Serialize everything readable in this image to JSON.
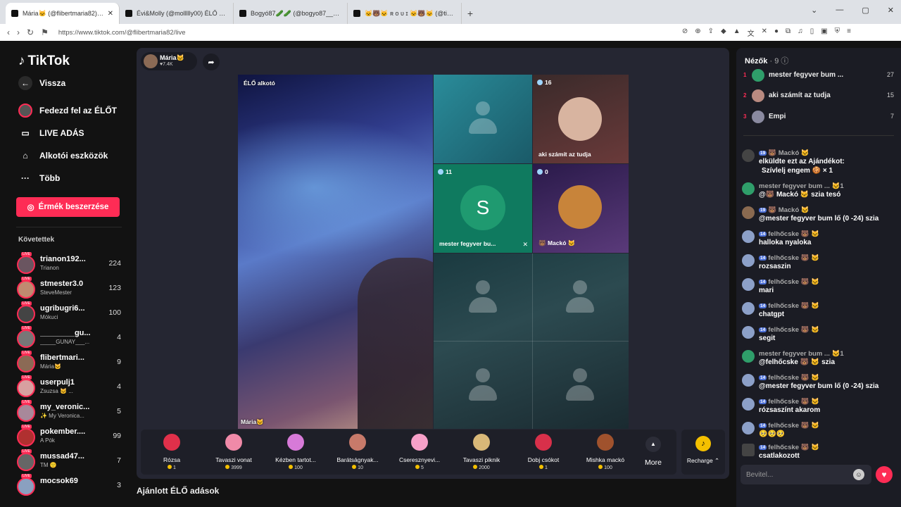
{
  "browser": {
    "tabs": [
      {
        "title": "Mária🐱 (@flibertmaria82) ÉL",
        "active": true
      },
      {
        "title": "Évi&Molly (@mollllly00) ÉLŐ adá",
        "active": false
      },
      {
        "title": "Bogyó87🥒🥒 (@bogyo87__) ÉLŐ adá",
        "active": false
      },
      {
        "title": "🐱🐻🐱 ʀ ᴏ ᴜ ɪ 🐱🐻🐱 (@tiktok.rolli",
        "active": false
      }
    ],
    "url": "https://www.tiktok.com/@flibertmaria82/live"
  },
  "sidebar": {
    "logo": "TikTok",
    "nav": [
      {
        "label": "Vissza",
        "icon": "back-arrow-icon"
      },
      {
        "label": "Fedezd fel az ÉLŐT",
        "icon": "explore-live-icon"
      },
      {
        "label": "LIVE ADÁS",
        "icon": "camera-icon"
      },
      {
        "label": "Alkotói eszközök",
        "icon": "home-tools-icon"
      },
      {
        "label": "Több",
        "icon": "more-dots-icon"
      }
    ],
    "coins_button": "Érmék beszerzése",
    "following_title": "Követettek",
    "following": [
      {
        "name": "trianon192...",
        "sub": "Trianon",
        "count": "224"
      },
      {
        "name": "stmester3.0",
        "sub": "SteveMester",
        "count": "123"
      },
      {
        "name": "ugribugri6...",
        "sub": "Mókuci",
        "count": "100"
      },
      {
        "name": "________gu...",
        "sub": "_____GUNAY___...",
        "count": "4"
      },
      {
        "name": "flibertmari...",
        "sub": "Mária🐱",
        "count": "9"
      },
      {
        "name": "userpulj1",
        "sub": "Zsuzsa 🐱 ...",
        "count": "4"
      },
      {
        "name": "my_veronic...",
        "sub": "✨ My Veronica...",
        "count": "5"
      },
      {
        "name": "pokember....",
        "sub": "A Pók",
        "count": "99"
      },
      {
        "name": "mussad47...",
        "sub": "TM 🙂",
        "count": "7"
      },
      {
        "name": "mocsok69",
        "sub": "",
        "count": "3"
      }
    ]
  },
  "stream": {
    "host_name": "Mária🐱",
    "host_likes": "♥7.4K",
    "main_tag": "ÉLŐ alkotó",
    "main_name": "Mária🐱",
    "guests": [
      {
        "count": "",
        "name": ""
      },
      {
        "count": "16",
        "name": "aki számít az tudja"
      },
      {
        "count": "11",
        "name": "mester fegyver bu..."
      },
      {
        "count": "0",
        "name": "🐻 Mackó 🐱"
      }
    ],
    "guest_initial": "S"
  },
  "gifts": [
    {
      "name": "Rózsa",
      "price": "1",
      "color": "#e0304a"
    },
    {
      "name": "Tavaszi vonat",
      "price": "3999",
      "color": "#f08aa8"
    },
    {
      "name": "Kézben tartot...",
      "price": "100",
      "color": "#d77ad8"
    },
    {
      "name": "Barátságnyak...",
      "price": "10",
      "color": "#c77a6a"
    },
    {
      "name": "Cseresznyevi...",
      "price": "5",
      "color": "#f6a0c8"
    },
    {
      "name": "Tavaszi piknik",
      "price": "2000",
      "color": "#d8b878"
    },
    {
      "name": "Dobj csókot",
      "price": "1",
      "color": "#d8304a"
    },
    {
      "name": "Mishka mackó",
      "price": "100",
      "color": "#a0522d"
    }
  ],
  "more_label": "More",
  "recharge_label": "Recharge ⌃",
  "below_heading": "Ajánlott ÉLŐ adások",
  "viewers": {
    "title": "Nézők",
    "count": "· 9",
    "ranks": [
      {
        "rank": "1",
        "name": "mester fegyver bum ...",
        "value": "27",
        "color": "#2f9e6a"
      },
      {
        "rank": "2",
        "name": "aki számít az tudja",
        "value": "15",
        "color": "#b98a80"
      },
      {
        "rank": "3",
        "name": "Empi",
        "value": "7",
        "color": "#8a8aa0"
      }
    ]
  },
  "chat": [
    {
      "head": "🐻 Mackó 🐱",
      "badge": "19",
      "msg": "elküldte ezt az Ajándékot:",
      "msg2": "Szívlelj engem 🍪 × 1",
      "color": "#444"
    },
    {
      "head": "mester fegyver bum ... 🐱1",
      "badge": "",
      "msg": "@🐻 Mackó 🐱 szia tesó",
      "msg2": "",
      "color": "#2f9e6a"
    },
    {
      "head": "🐻 Mackó 🐱",
      "badge": "19",
      "msg": "@mester fegyver bum lő (0 -24) szia",
      "msg2": "",
      "color": "#8a6a50"
    },
    {
      "head": "felhőcske 🐻 🐱",
      "badge": "14",
      "msg": "halloka nyaloka",
      "msg2": "",
      "color": "#8ca0c8"
    },
    {
      "head": "felhőcske 🐻 🐱",
      "badge": "14",
      "msg": "rozsaszin",
      "msg2": "",
      "color": "#8ca0c8"
    },
    {
      "head": "felhőcske 🐻 🐱",
      "badge": "14",
      "msg": "mari",
      "msg2": "",
      "color": "#8ca0c8"
    },
    {
      "head": "felhőcske 🐻 🐱",
      "badge": "14",
      "msg": "chatgpt",
      "msg2": "",
      "color": "#8ca0c8"
    },
    {
      "head": "felhőcske 🐻 🐱",
      "badge": "14",
      "msg": "segit",
      "msg2": "",
      "color": "#8ca0c8"
    },
    {
      "head": "mester fegyver bum ... 🐱1",
      "badge": "",
      "msg": "@felhőcske 🐻 🐱 szia",
      "msg2": "",
      "color": "#2f9e6a"
    },
    {
      "head": "felhőcske 🐻 🐱",
      "badge": "14",
      "msg": "@mester fegyver bum lő (0 -24) szia",
      "msg2": "",
      "color": "#8ca0c8"
    },
    {
      "head": "felhőcske 🐻 🐱",
      "badge": "14",
      "msg": "rózsaszínt akarom",
      "msg2": "",
      "color": "#8ca0c8"
    },
    {
      "head": "felhőcske 🐻 🐱",
      "badge": "14",
      "msg": "🥺🥺🥺",
      "msg2": "",
      "color": "#8ca0c8"
    },
    {
      "head": "felhőcske 🐻 🐱",
      "badge": "14",
      "msg": "csatlakozott",
      "msg2": "",
      "color": "#444"
    }
  ],
  "chat_input_placeholder": "Bevitel..."
}
